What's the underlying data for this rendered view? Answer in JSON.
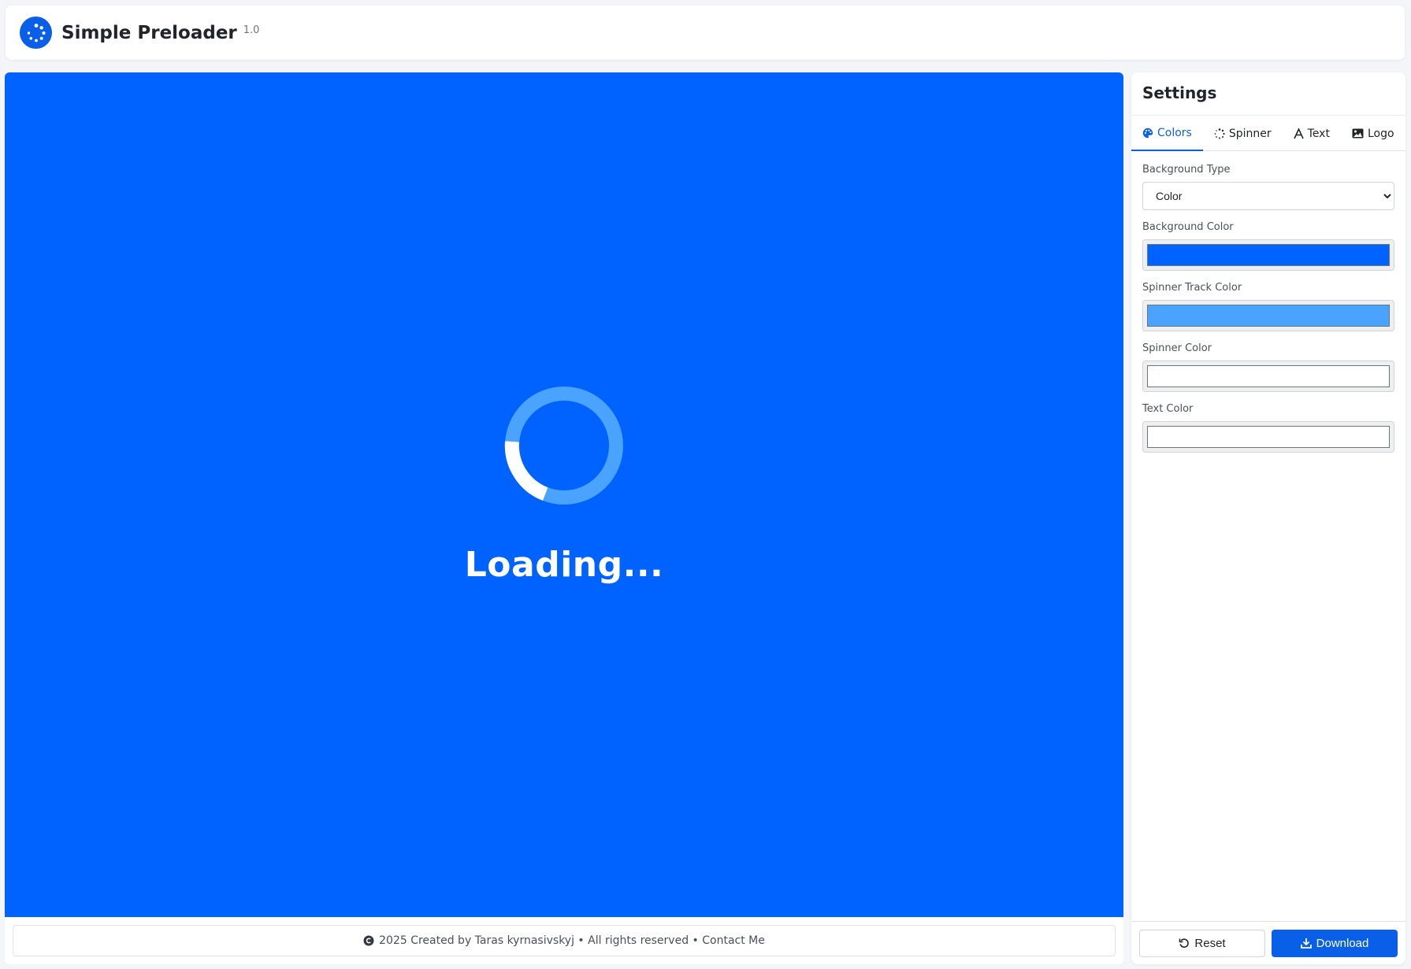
{
  "header": {
    "title": "Simple Preloader",
    "version": "1.0",
    "logo_icon": "dotted-spinner-icon"
  },
  "preview": {
    "background_color": "#0062ff",
    "spinner_track_color": "#4aa3ff",
    "spinner_color": "#ffffff",
    "text_color": "#ffffff",
    "loading_text": "Loading..."
  },
  "footer": {
    "text": "2025 Created by Taras kyrnasivskyj • All rights reserved • Contact Me",
    "icon": "copyright-icon"
  },
  "settings": {
    "title": "Settings",
    "tabs": [
      {
        "label": "Colors",
        "icon": "palette-icon",
        "active": true
      },
      {
        "label": "Spinner",
        "icon": "spinner-icon",
        "active": false
      },
      {
        "label": "Text",
        "icon": "text-font-icon",
        "active": false
      },
      {
        "label": "Logo",
        "icon": "image-icon",
        "active": false
      }
    ],
    "fields": {
      "background_type": {
        "label": "Background Type",
        "value": "Color"
      },
      "background_color": {
        "label": "Background Color",
        "value": "#0062ff"
      },
      "spinner_track_color": {
        "label": "Spinner Track Color",
        "value": "#4aa3ff"
      },
      "spinner_color": {
        "label": "Spinner Color",
        "value": "#ffffff"
      },
      "text_color": {
        "label": "Text Color",
        "value": "#ffffff"
      }
    },
    "buttons": {
      "reset": {
        "label": "Reset",
        "icon": "undo-icon"
      },
      "download": {
        "label": "Download",
        "icon": "download-icon"
      }
    }
  }
}
